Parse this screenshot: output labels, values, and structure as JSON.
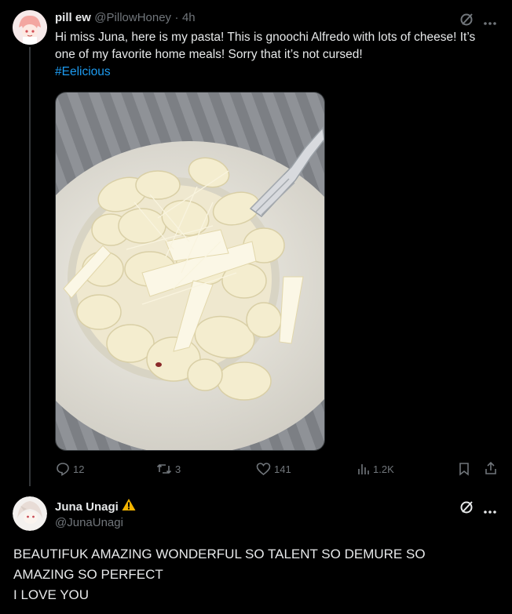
{
  "post": {
    "display_name": "pill ew",
    "handle": "@PillowHoney",
    "time": "4h",
    "separator": "·",
    "text": "Hi miss Juna, here is my pasta! This is gnoochi Alfredo with lots of cheese! It’s one of my favorite home meals! Sorry that it’s not cursed!",
    "hashtag": "#Eelicious",
    "image_icon": "gnocchi-photo",
    "stats": {
      "replies": "12",
      "reposts": "3",
      "likes": "141",
      "views": "1.2K"
    }
  },
  "reply": {
    "display_name": "Juna Unagi",
    "badge_icon": "warning-icon",
    "handle": "@JunaUnagi",
    "text_line1": "BEAUTIFUK AMAZING WONDERFUL SO TALENT SO DEMURE SO",
    "text_line2": "AMAZING SO PERFECT",
    "text_line3": "I LOVE YOU"
  },
  "colors": {
    "background": "#000000",
    "text": "#e7e9ea",
    "muted": "#71767b",
    "link": "#1d9bf0",
    "warning": "#f4b400"
  }
}
